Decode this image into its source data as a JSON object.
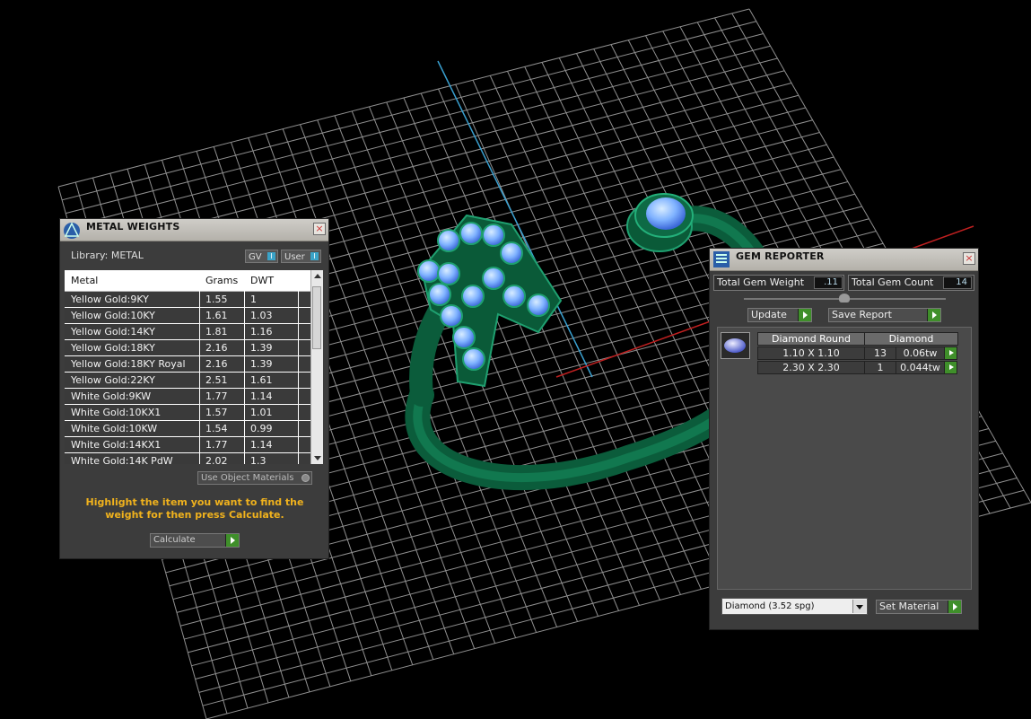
{
  "metal_weights": {
    "title": "METAL WEIGHTS",
    "library_label": "Library: METAL",
    "toggle_gv": "GV",
    "toggle_user": "User",
    "toggle_indicator": "I",
    "columns": [
      "Metal",
      "Grams",
      "DWT"
    ],
    "rows": [
      {
        "metal": "Yellow Gold:9KY",
        "grams": "1.55",
        "dwt": "1"
      },
      {
        "metal": "Yellow Gold:10KY",
        "grams": "1.61",
        "dwt": "1.03"
      },
      {
        "metal": "Yellow Gold:14KY",
        "grams": "1.81",
        "dwt": "1.16"
      },
      {
        "metal": "Yellow Gold:18KY",
        "grams": "2.16",
        "dwt": "1.39"
      },
      {
        "metal": "Yellow Gold:18KY Royal",
        "grams": "2.16",
        "dwt": "1.39"
      },
      {
        "metal": "Yellow Gold:22KY",
        "grams": "2.51",
        "dwt": "1.61"
      },
      {
        "metal": "White Gold:9KW",
        "grams": "1.77",
        "dwt": "1.14"
      },
      {
        "metal": "White Gold:10KX1",
        "grams": "1.57",
        "dwt": "1.01"
      },
      {
        "metal": "White Gold:10KW",
        "grams": "1.54",
        "dwt": "0.99"
      },
      {
        "metal": "White Gold:14KX1",
        "grams": "1.77",
        "dwt": "1.14"
      },
      {
        "metal": "White Gold:14K PdW",
        "grams": "2.02",
        "dwt": "1.3"
      }
    ],
    "use_object_materials": "Use Object Materials",
    "hint": "Highlight the item you want to find the weight for then press Calculate.",
    "calculate": "Calculate"
  },
  "gem_reporter": {
    "title": "GEM REPORTER",
    "total_gem_weight_label": "Total Gem Weight",
    "total_gem_weight_value": ".11",
    "total_gem_count_label": "Total Gem Count",
    "total_gem_count_value": "14",
    "update": "Update",
    "save_report": "Save Report",
    "gem_headers": [
      "Diamond Round",
      "Diamond"
    ],
    "gem_rows": [
      {
        "size": "1.10 X 1.10",
        "count": "13",
        "weight": "0.06tw"
      },
      {
        "size": "2.30 X 2.30",
        "count": "1",
        "weight": "0.044tw"
      }
    ],
    "material_select": "Diamond     (3.52 spg)",
    "set_material": "Set Material"
  },
  "colors": {
    "background": "#000000",
    "grid": "#bdbdbd",
    "ring_green": "#0d6b45",
    "gem_blue": "#6aa8ff",
    "hint_orange": "#f0b21d",
    "go_green": "#3f8f2a"
  }
}
